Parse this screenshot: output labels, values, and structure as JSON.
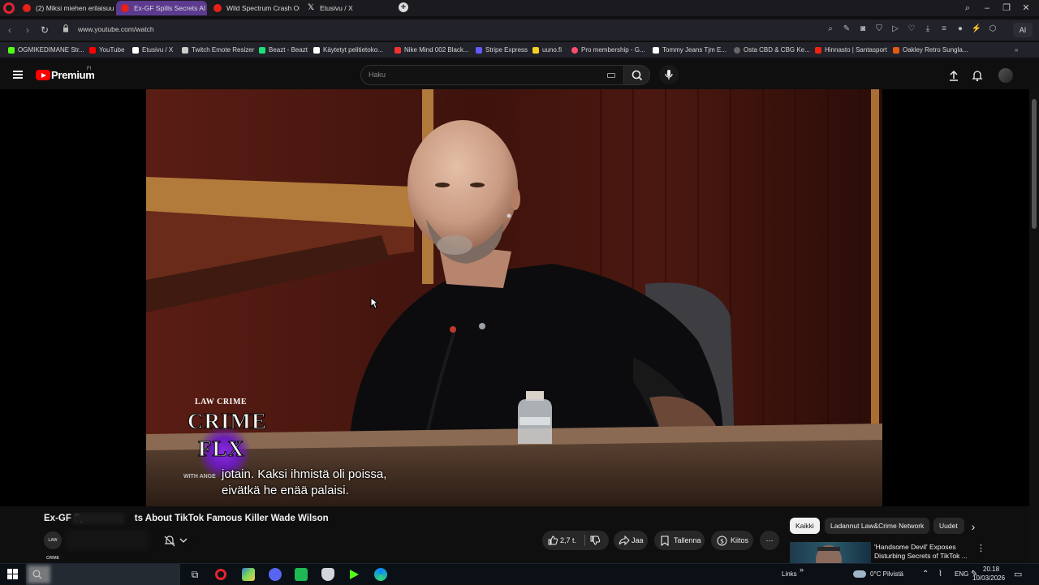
{
  "browser": {
    "tabs": [
      {
        "label": "(2) Miksi miehen erilaisuu"
      },
      {
        "label": "Ex-GF Spills Secrets Al"
      },
      {
        "label": "Wild Spectrum Crash Out"
      },
      {
        "label": "Etusivu / X"
      }
    ],
    "url": "www.youtube.com/watch",
    "ai_label": "AI",
    "bookmarks": [
      {
        "label": "OGMIKEDIMANE Str..."
      },
      {
        "label": "YouTube"
      },
      {
        "label": "Etusivu / X"
      },
      {
        "label": "Twitch Emote Resizer"
      },
      {
        "label": "Beazt - Beazt"
      },
      {
        "label": "Käytetyt pelitietoko..."
      },
      {
        "label": "Nike Mind 002 Black..."
      },
      {
        "label": "Stripe Express"
      },
      {
        "label": "uuno.fi"
      },
      {
        "label": "Pro membership - G..."
      },
      {
        "label": "Tommy Jeans Tjm E..."
      },
      {
        "label": "Osta CBD & CBG Ke..."
      },
      {
        "label": "Hinnasto | Santasport"
      },
      {
        "label": "Oakley Retro Sungla..."
      }
    ]
  },
  "youtube": {
    "logo_label": "Premium",
    "country_code": "FI",
    "search_placeholder": "Haku",
    "video": {
      "subtitle_line1": "jotain.  Kaksi ihmistä oli poissa,",
      "subtitle_line2": "eivätkä he enää palaisi.",
      "watermark_top": "LAW CRIME",
      "watermark_word1": "CRIME",
      "watermark_word2": "FLX",
      "watermark_bottom": "WITH ANGE"
    },
    "title": "Ex-GF Spills Secrets About TikTok Famous Killer Wade Wilson",
    "title_visible_prefix": "Ex-GF Sp",
    "title_visible_suffix": "ts About TikTok Famous Killer Wade Wilson",
    "channel_avatar_text": "LAW CRIME",
    "actions": {
      "like_count": "2,7 t.",
      "share": "Jaa",
      "save": "Tallenna",
      "thanks": "Kiitos"
    },
    "chips": [
      {
        "label": "Kaikki"
      },
      {
        "label": "Ladannut Law&Crime Network"
      },
      {
        "label": "Uudet"
      }
    ],
    "recommendation": {
      "title": "'Handsome Devil' Exposes Disturbing Secrets of TikTok ..."
    }
  },
  "taskbar": {
    "links_label": "Links",
    "weather": "0°C  Pilvistä",
    "language": "ENG",
    "time": "20.18",
    "date": "10/03/2026"
  }
}
